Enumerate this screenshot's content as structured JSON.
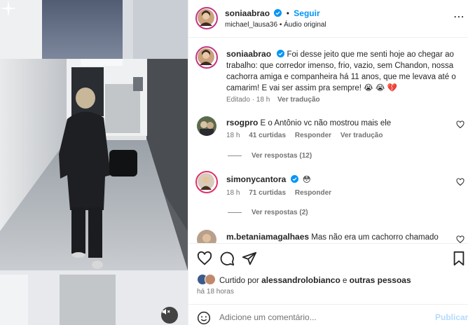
{
  "post": {
    "author": "soniaabrao",
    "follow_label": "Seguir",
    "audio_line": "michael_lausa36 • Áudio original"
  },
  "caption": {
    "author": "soniaabrao",
    "text": "Foi desse jeito que me senti hoje ao chegar ao trabalho: que corredor imenso, frio, vazio, sem Chandon, nossa cachorra amiga e companheira há 11 anos, que me levava até o camarim! E vai ser assim pra sempre! 😭 😭 💔",
    "meta": "Editado · 18 h",
    "translate": "Ver tradução"
  },
  "comments": [
    {
      "user": "rsogpro",
      "text": "E o Antônio vc não mostrou mais ele",
      "time": "18 h",
      "likes": "41 curtidas",
      "reply": "Responder",
      "translate": "Ver tradução",
      "view_replies": "Ver respostas (12)"
    },
    {
      "user": "simonycantora",
      "text": "😳",
      "time": "18 h",
      "likes": "71 curtidas",
      "reply": "Responder",
      "view_replies": "Ver respostas (2)"
    },
    {
      "user": "m.betaniamagalhaes",
      "text": "Mas não era um cachorro chamado"
    }
  ],
  "likes": {
    "prefix": "Curtido por",
    "user": "alessandrolobianco",
    "mid": "e",
    "others": "outras pessoas",
    "time_ago": "há 18 horas"
  },
  "composer": {
    "placeholder": "Adicione um comentário...",
    "publish": "Publicar"
  },
  "colors": {
    "link_blue": "#0095f6",
    "verified_blue": "#0095f6",
    "story_ring": "#c13584",
    "muted_text": "#737373"
  },
  "icons": [
    "heart-icon",
    "comment-icon",
    "share-icon",
    "bookmark-icon",
    "smile-icon",
    "mute-icon",
    "sparkle-icon",
    "verified-icon"
  ]
}
